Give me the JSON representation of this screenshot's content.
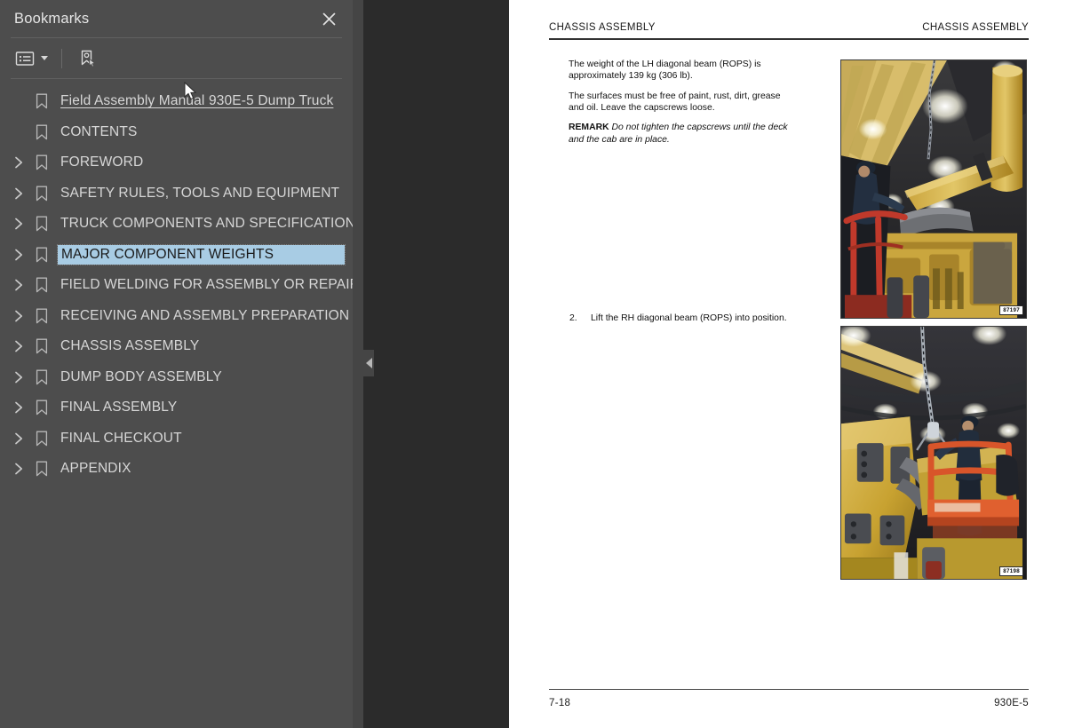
{
  "sidebar": {
    "title": "Bookmarks",
    "close_icon": "close-icon",
    "toolbar": {
      "options_icon": "list-options-icon",
      "caret_icon": "chevron-down-icon",
      "new_bookmark_icon": "new-bookmark-icon"
    },
    "items": [
      {
        "label": "Field Assembly Manual 930E-5 Dump Truck",
        "expandable": false,
        "root": true,
        "selected": false
      },
      {
        "label": "CONTENTS",
        "expandable": false,
        "root": false,
        "selected": false
      },
      {
        "label": "FOREWORD",
        "expandable": true,
        "root": false,
        "selected": false
      },
      {
        "label": "SAFETY RULES, TOOLS AND EQUIPMENT",
        "expandable": true,
        "root": false,
        "selected": false
      },
      {
        "label": "TRUCK COMPONENTS AND SPECIFICATIONS",
        "expandable": true,
        "root": false,
        "selected": false
      },
      {
        "label": "MAJOR COMPONENT WEIGHTS",
        "expandable": true,
        "root": false,
        "selected": true
      },
      {
        "label": "FIELD WELDING FOR ASSEMBLY OR REPAIR",
        "expandable": true,
        "root": false,
        "selected": false
      },
      {
        "label": "RECEIVING AND ASSEMBLY PREPARATION",
        "expandable": true,
        "root": false,
        "selected": false
      },
      {
        "label": "CHASSIS ASSEMBLY",
        "expandable": true,
        "root": false,
        "selected": false
      },
      {
        "label": "DUMP BODY ASSEMBLY",
        "expandable": true,
        "root": false,
        "selected": false
      },
      {
        "label": "FINAL ASSEMBLY",
        "expandable": true,
        "root": false,
        "selected": false
      },
      {
        "label": "FINAL CHECKOUT",
        "expandable": true,
        "root": false,
        "selected": false
      },
      {
        "label": "APPENDIX",
        "expandable": true,
        "root": false,
        "selected": false
      }
    ]
  },
  "gutter": {
    "collapse_icon": "collapse-panel-icon"
  },
  "document": {
    "header_left": "CHASSIS ASSEMBLY",
    "header_right": "CHASSIS ASSEMBLY",
    "paragraphs": [
      "The weight of the LH diagonal beam (ROPS) is approximately 139 kg (306 lb).",
      "The surfaces must be free of paint, rust, dirt, grease and oil. Leave the capscrews loose."
    ],
    "remark_label": "REMARK",
    "remark_text": "Do not tighten the capscrews until the deck and the cab are in place.",
    "step_number": "2.",
    "step_text": "Lift the RH diagonal beam (ROPS) into position.",
    "figures": [
      {
        "caption": "87197",
        "alt": "Technician on lift platform beside yellow diagonal beam and engine"
      },
      {
        "caption": "87198",
        "alt": "Technician on orange lift platform positioning RH diagonal beam with chain hoist"
      }
    ],
    "footer_left": "7-18",
    "footer_right": "930E-5"
  },
  "colors": {
    "sidebar_bg": "#4d4d4d",
    "gutter_bg": "#2b2b2b",
    "highlight": "#a8cce4",
    "text_light": "#d7d7d7",
    "page_bg": "#ffffff"
  }
}
